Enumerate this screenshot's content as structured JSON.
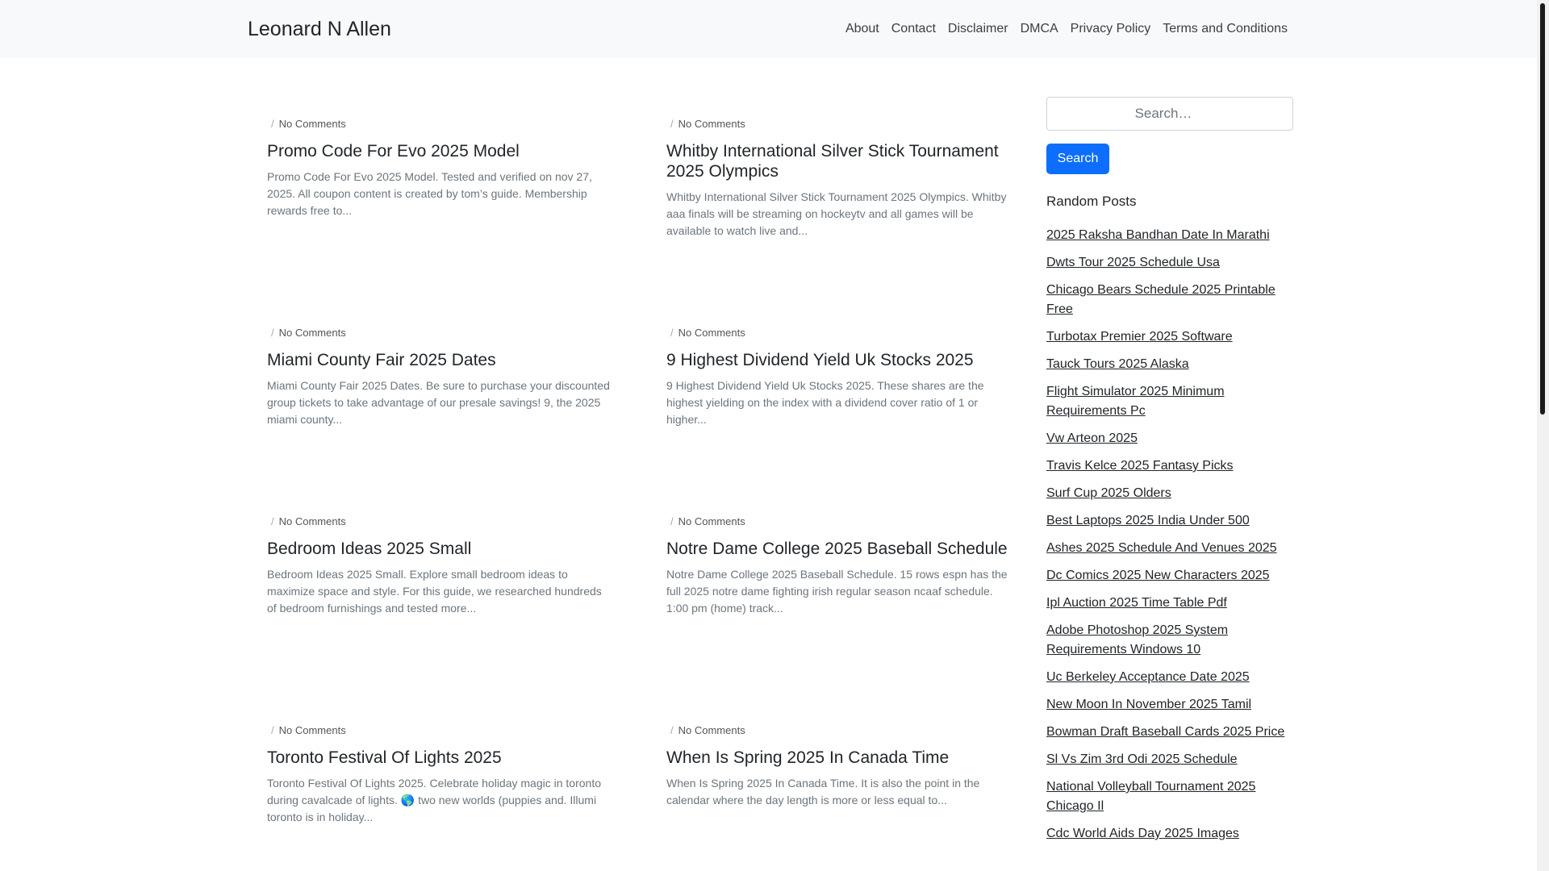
{
  "site": {
    "brand": "Leonard N Allen"
  },
  "nav": [
    "About",
    "Contact",
    "Disclaimer",
    "DMCA",
    "Privacy Policy",
    "Terms and Conditions"
  ],
  "posts": [
    {
      "meta": "No Comments",
      "title": "Promo Code For Evo 2025 Model",
      "excerpt": "Promo Code For Evo 2025 Model. Tested and verified on nov 27, 2025. All coupon content is created by tom’s guide. Membership rewards free to..."
    },
    {
      "meta": "No Comments",
      "title": "Whitby International Silver Stick Tournament 2025 Olympics",
      "excerpt": "Whitby International Silver Stick Tournament 2025 Olympics. Whitby aaa finals will be streaming on hockeytv and all games will be available to watch live and..."
    },
    {
      "meta": "No Comments",
      "title": "Miami County Fair 2025 Dates",
      "excerpt": "Miami County Fair 2025 Dates. Be sure to purchase your discounted group tickets to take advantage of our presale savings! 9, the 2025 miami county..."
    },
    {
      "meta": "No Comments",
      "title": "9 Highest Dividend Yield Uk Stocks 2025",
      "excerpt": "9 Highest Dividend Yield Uk Stocks 2025. These shares are the highest yielding on the index with a dividend cover ratio of 1 or higher..."
    },
    {
      "meta": "No Comments",
      "title": "Bedroom Ideas 2025 Small",
      "excerpt": "Bedroom Ideas 2025 Small. Explore small bedroom ideas to maximize space and style. For this guide, we researched hundreds of bedroom furnishings and tested more..."
    },
    {
      "meta": "No Comments",
      "title": "Notre Dame College 2025 Baseball Schedule",
      "excerpt": "Notre Dame College 2025 Baseball Schedule. 15 rows espn has the full 2025 notre dame fighting irish regular season ncaaf schedule. 1:00 pm (home) track..."
    },
    {
      "meta": "No Comments",
      "title": "Toronto Festival Of Lights 2025",
      "excerpt": "Toronto Festival Of Lights 2025. Celebrate holiday magic in toronto during cavalcade of lights. 🌎 two new worlds (puppies and. Illumi toronto is in holiday..."
    },
    {
      "meta": "No Comments",
      "title": "When Is Spring 2025 In Canada Time",
      "excerpt": "When Is Spring 2025 In Canada Time. It is also the point in the calendar where the day length is more or less equal to..."
    }
  ],
  "sidebar": {
    "search_placeholder": "Search…",
    "search_button": "Search",
    "random_title": "Random Posts",
    "random_posts": [
      "2025 Raksha Bandhan Date In Marathi",
      "Dwts Tour 2025 Schedule Usa",
      "Chicago Bears Schedule 2025 Printable Free",
      "Turbotax Premier 2025 Software",
      "Tauck Tours 2025 Alaska",
      "Flight Simulator 2025 Minimum Requirements Pc",
      "Vw Arteon 2025",
      "Travis Kelce 2025 Fantasy Picks",
      "Surf Cup 2025 Olders",
      "Best Laptops 2025 India Under 500",
      "Ashes 2025 Schedule And Venues 2025",
      "Dc Comics 2025 New Characters 2025",
      "Ipl Auction 2025 Time Table Pdf",
      "Adobe Photoshop 2025 System Requirements Windows 10",
      "Uc Berkeley Acceptance Date 2025",
      "New Moon In November 2025 Tamil",
      "Bowman Draft Baseball Cards 2025 Price",
      "Sl Vs Zim 3rd Odi 2025 Schedule",
      "National Volleyball Tournament 2025 Chicago Il",
      "Cdc World Aids Day 2025 Images"
    ]
  }
}
